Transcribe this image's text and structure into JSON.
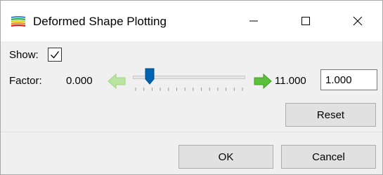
{
  "window": {
    "title": "Deformed Shape Plotting",
    "app_icon": "rainbow-shape-icon",
    "controls": {
      "minimize_icon": "minimize-icon",
      "maximize_icon": "maximize-icon",
      "close_icon": "close-icon"
    }
  },
  "show": {
    "label": "Show:",
    "checked": true
  },
  "factor": {
    "label": "Factor:",
    "min_value": "0.000",
    "max_value": "11.000",
    "input_value": "1.000",
    "slider_fraction": 0.11,
    "tick_count": 14,
    "decrease_icon": "arrow-left-icon",
    "increase_icon": "arrow-right-icon"
  },
  "buttons": {
    "reset": "Reset",
    "ok": "OK",
    "cancel": "Cancel"
  },
  "colors": {
    "arrow_left": "#b9e5a0",
    "arrow_right": "#5cc13a",
    "slider_thumb": "#0063b1",
    "title_bar": "#ffffff",
    "dialog_bg": "#f0f0f0"
  }
}
